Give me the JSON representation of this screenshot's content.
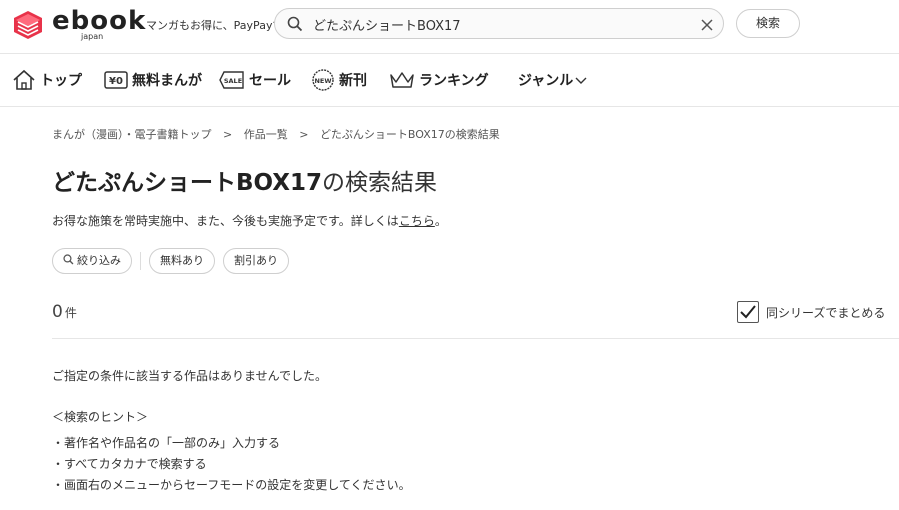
{
  "header": {
    "logo_text": "ebook",
    "logo_sub": "japan",
    "tagline": "マンガもお得に、PayPayで",
    "search_value": "どたぷんショートBOX17",
    "search_button": "検索"
  },
  "nav": {
    "items": [
      {
        "label": "トップ",
        "icon": "home-icon"
      },
      {
        "label": "無料まんが",
        "icon": "free-yen-icon"
      },
      {
        "label": "セール",
        "icon": "sale-tag-icon"
      },
      {
        "label": "新刊",
        "icon": "new-badge-icon"
      },
      {
        "label": "ランキング",
        "icon": "crown-icon"
      },
      {
        "label": "ジャンル",
        "icon": "chevron-down-icon"
      }
    ]
  },
  "breadcrumb": [
    "まんが（漫画）・電子書籍トップ",
    ">",
    "作品一覧",
    ">",
    "どたぷんショートBOX17の検索結果"
  ],
  "title": {
    "query": "どたぷんショートBOX17",
    "suffix": "の検索結果"
  },
  "promo": {
    "text": "お得な施策を常時実施中、また、今後も実施予定です。詳しくは",
    "link": "こちら",
    "end": "。"
  },
  "filters": {
    "narrow": "絞り込み",
    "free": "無料あり",
    "discount": "割引あり"
  },
  "results": {
    "count": "0",
    "unit": "件",
    "group_series_label": "同シリーズでまとめる",
    "group_series_checked": true
  },
  "messages": {
    "no_results": "ご指定の条件に該当する作品はありませんでした。",
    "hint_title": "＜検索のヒント＞",
    "hints": [
      "・著作名や作品名の「一部のみ」入力する",
      "・すべてカタカナで検索する",
      "・画面右のメニューからセーフモードの設定を変更してください。"
    ]
  },
  "colors": {
    "brand_red": "#e8334a",
    "text": "#333333",
    "border": "#cfcfcf"
  }
}
